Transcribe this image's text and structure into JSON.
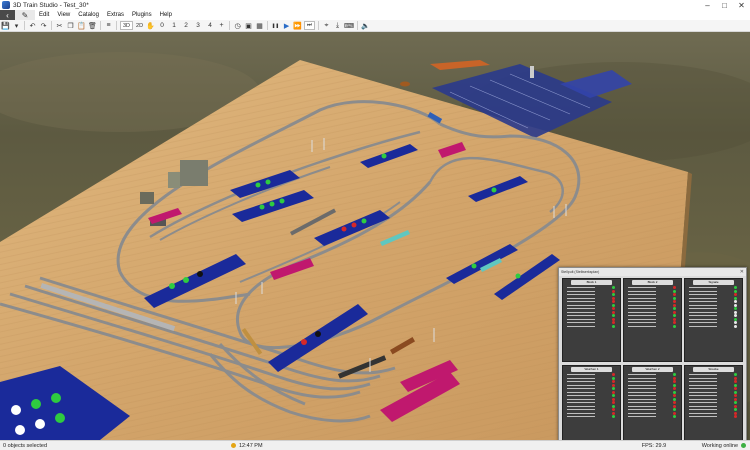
{
  "window": {
    "title": "3D Train Studio - Test_30*",
    "minimize_icon": "–",
    "maximize_icon": "□",
    "close_icon": "✕"
  },
  "menu": {
    "back_icon": "‹",
    "edit_mode_icon": "✎",
    "items": [
      "Edit",
      "View",
      "Catalog",
      "Extras",
      "Plugins",
      "Help"
    ]
  },
  "toolbar": {
    "save_icon": "💾",
    "dropdown_icon": "▾",
    "undo_icon": "↶",
    "redo_icon": "↷",
    "cut_icon": "✂",
    "copy_icon": "❐",
    "paste_icon": "📋",
    "delete_icon": "🗑",
    "list_icon": "≡",
    "view_3d": "3D",
    "view_2d": "2D",
    "hand_icon": "✋",
    "views": [
      "0",
      "1",
      "2",
      "3",
      "4"
    ],
    "add_view_icon": "+",
    "timer_icon": "◷",
    "screenshot_icon": "▣",
    "grid_icon": "▦",
    "pause_icon": "❚❚",
    "play_icon": "▶",
    "fast_icon": "⏩",
    "faster_icon": "⏭",
    "select_icon": "⌖",
    "download_icon": "⤓",
    "keyboard_icon": "⌨",
    "sound_icon": "🔈"
  },
  "panel": {
    "title": "Stellpult (Stellwerksplan)",
    "close_icon": "✕",
    "columns": [
      {
        "title": "Block 1"
      },
      {
        "title": "Block 2"
      },
      {
        "title": "Signale"
      },
      {
        "title": "Weichen 1"
      },
      {
        "title": "Weichen 2"
      },
      {
        "title": "Strecke"
      }
    ]
  },
  "status": {
    "selection": "0 objects selected",
    "time": "12:47 PM",
    "fps": "FPS: 29.9",
    "online": "Working online"
  },
  "colors": {
    "board": "#cfa36a",
    "ground": "#625e45",
    "track": "#8a8a8a",
    "sign_blue": "#1a2a9a",
    "sign_pink": "#c0186e",
    "signal_green": "#2ecc40",
    "signal_red": "#d62828"
  }
}
